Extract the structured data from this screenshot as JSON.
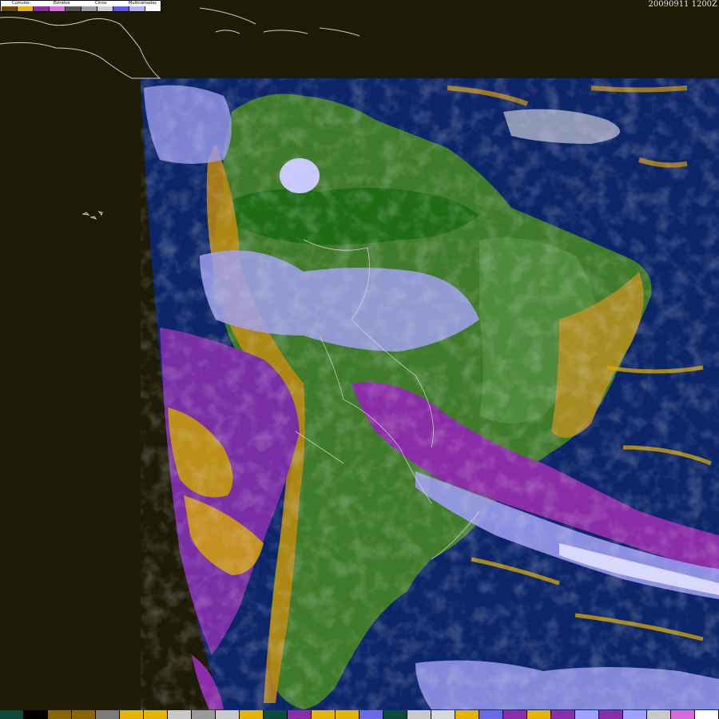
{
  "timestamp": "20090911 1200Z",
  "legend": {
    "labels": [
      "Cúmulos",
      "Estratos",
      "Cirros",
      "Multicamadas"
    ],
    "swatches": [
      "#6b4a00",
      "#e6b400",
      "#8b2ca8",
      "#d96ad9",
      "#555555",
      "#9a9a9a",
      "#cfcfcf",
      "#5a5ae6",
      "#b0b0ff",
      "#ffffff"
    ]
  },
  "map": {
    "ocean_color": "#0b2568",
    "land_color": "#3f7a2a",
    "space_color": "#1d1a06"
  },
  "bottom_palette": [
    "#0c4a3a",
    "#000000",
    "#8a6400",
    "#8a6400",
    "#7a7a7a",
    "#e6b400",
    "#e6b400",
    "#c8c8c8",
    "#9a9a9a",
    "#c8c8c8",
    "#e6b400",
    "#0c4a3a",
    "#8b2ca8",
    "#e6b400",
    "#e6b400",
    "#6a6ae6",
    "#0c4a3a",
    "#c8c8c8",
    "#d8d8d8",
    "#e6b400",
    "#6a6ae6",
    "#8b2ca8",
    "#e6b400",
    "#8b2ca8",
    "#a0a0ff",
    "#8b2ca8",
    "#a0a0ff",
    "#c8c8c8",
    "#d96ad9",
    "#ffffff"
  ]
}
